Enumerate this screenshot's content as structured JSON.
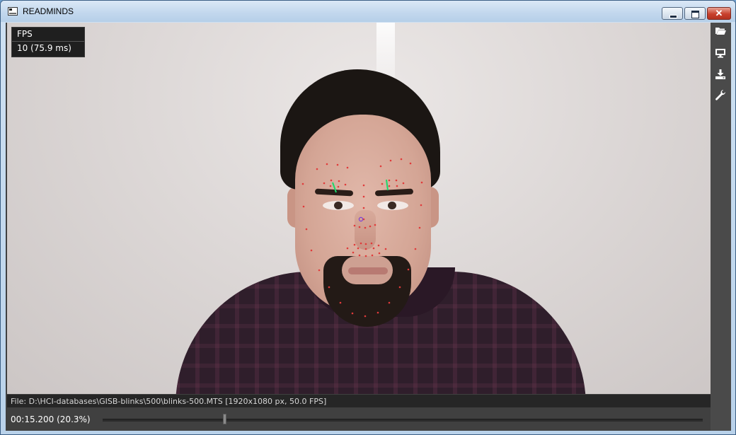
{
  "window": {
    "title": "READMINDS",
    "close_glyph": "✕",
    "icons": [
      "app-icon",
      "minimize-icon",
      "maximize-icon",
      "close-icon"
    ]
  },
  "overlay": {
    "fps_label": "FPS",
    "fps_value": "10 (75.9 ms)"
  },
  "toolbar": {
    "icons": [
      "folder-open-icon",
      "monitor-icon",
      "download-icon",
      "wrench-icon"
    ]
  },
  "status": {
    "file_info": "File: D:\\HCI-databases\\GISB-blinks\\500\\blinks-500.MTS [1920x1080 px, 50.0 FPS]"
  },
  "playback": {
    "time": "00:15.200 (20.3%)",
    "progress_fraction": 0.203
  },
  "colors": {
    "landmark": "#e03b3b",
    "gaze": "#19d96a",
    "nose_marker": "#7a3fd6",
    "panel": "#404040"
  }
}
